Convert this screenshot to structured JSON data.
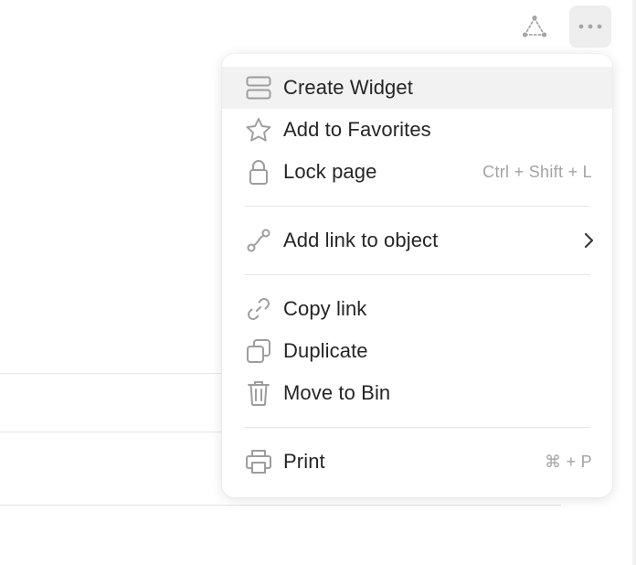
{
  "toolbar": {
    "graph_icon": "graph-icon",
    "more_icon": "more-icon"
  },
  "menu": {
    "groups": [
      [
        {
          "label": "Create Widget",
          "icon": "widget-icon",
          "highlighted": true
        },
        {
          "label": "Add to Favorites",
          "icon": "star-icon"
        },
        {
          "label": "Lock page",
          "icon": "lock-icon",
          "shortcut": "Ctrl + Shift + L"
        }
      ],
      [
        {
          "label": "Add link to object",
          "icon": "relation-link-icon",
          "submenu": true
        }
      ],
      [
        {
          "label": "Copy link",
          "icon": "link-icon"
        },
        {
          "label": "Duplicate",
          "icon": "duplicate-icon"
        },
        {
          "label": "Move to Bin",
          "icon": "trash-icon"
        }
      ],
      [
        {
          "label": "Print",
          "icon": "print-icon",
          "shortcut": "⌘ + P"
        }
      ]
    ]
  },
  "colors": {
    "icon": "#9d9d9d",
    "highlight": "#f2f2f2",
    "text": "#252525",
    "shortcut": "#a3a3a3"
  }
}
